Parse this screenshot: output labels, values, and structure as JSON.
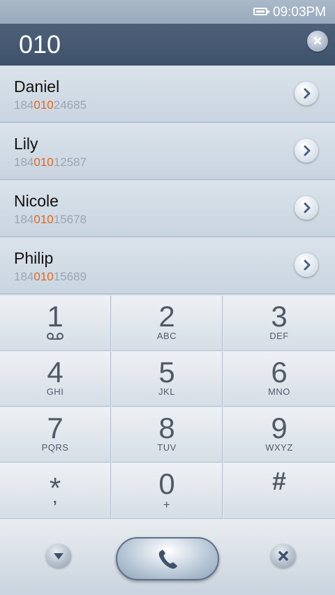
{
  "status_bar": {
    "time": "09:03PM",
    "icons": [
      "battery-icon"
    ]
  },
  "search": {
    "query": "010",
    "clear_icon": "close-icon"
  },
  "highlight_color": "#e0661c",
  "contacts": [
    {
      "name": "Daniel",
      "number_prefix": "184",
      "number_match": "010",
      "number_suffix": "24685"
    },
    {
      "name": "Lily",
      "number_prefix": "184",
      "number_match": "010",
      "number_suffix": "12587"
    },
    {
      "name": "Nicole",
      "number_prefix": "184",
      "number_match": "010",
      "number_suffix": "15678"
    },
    {
      "name": "Philip",
      "number_prefix": "184",
      "number_match": "010",
      "number_suffix": "15689"
    }
  ],
  "keypad": [
    {
      "digit": "1",
      "letters": ""
    },
    {
      "digit": "2",
      "letters": "ABC"
    },
    {
      "digit": "3",
      "letters": "DEF"
    },
    {
      "digit": "4",
      "letters": "GHI"
    },
    {
      "digit": "5",
      "letters": "JKL"
    },
    {
      "digit": "6",
      "letters": "MNO"
    },
    {
      "digit": "7",
      "letters": "PQRS"
    },
    {
      "digit": "8",
      "letters": "TUV"
    },
    {
      "digit": "9",
      "letters": "WXYZ"
    },
    {
      "digit": "*",
      "letters": ","
    },
    {
      "digit": "0",
      "letters": "+"
    },
    {
      "digit": "#",
      "letters": ""
    }
  ],
  "bottom_bar": {
    "left_icon": "hide-keypad-icon",
    "call_icon": "phone-icon",
    "right_icon": "backspace-icon"
  }
}
